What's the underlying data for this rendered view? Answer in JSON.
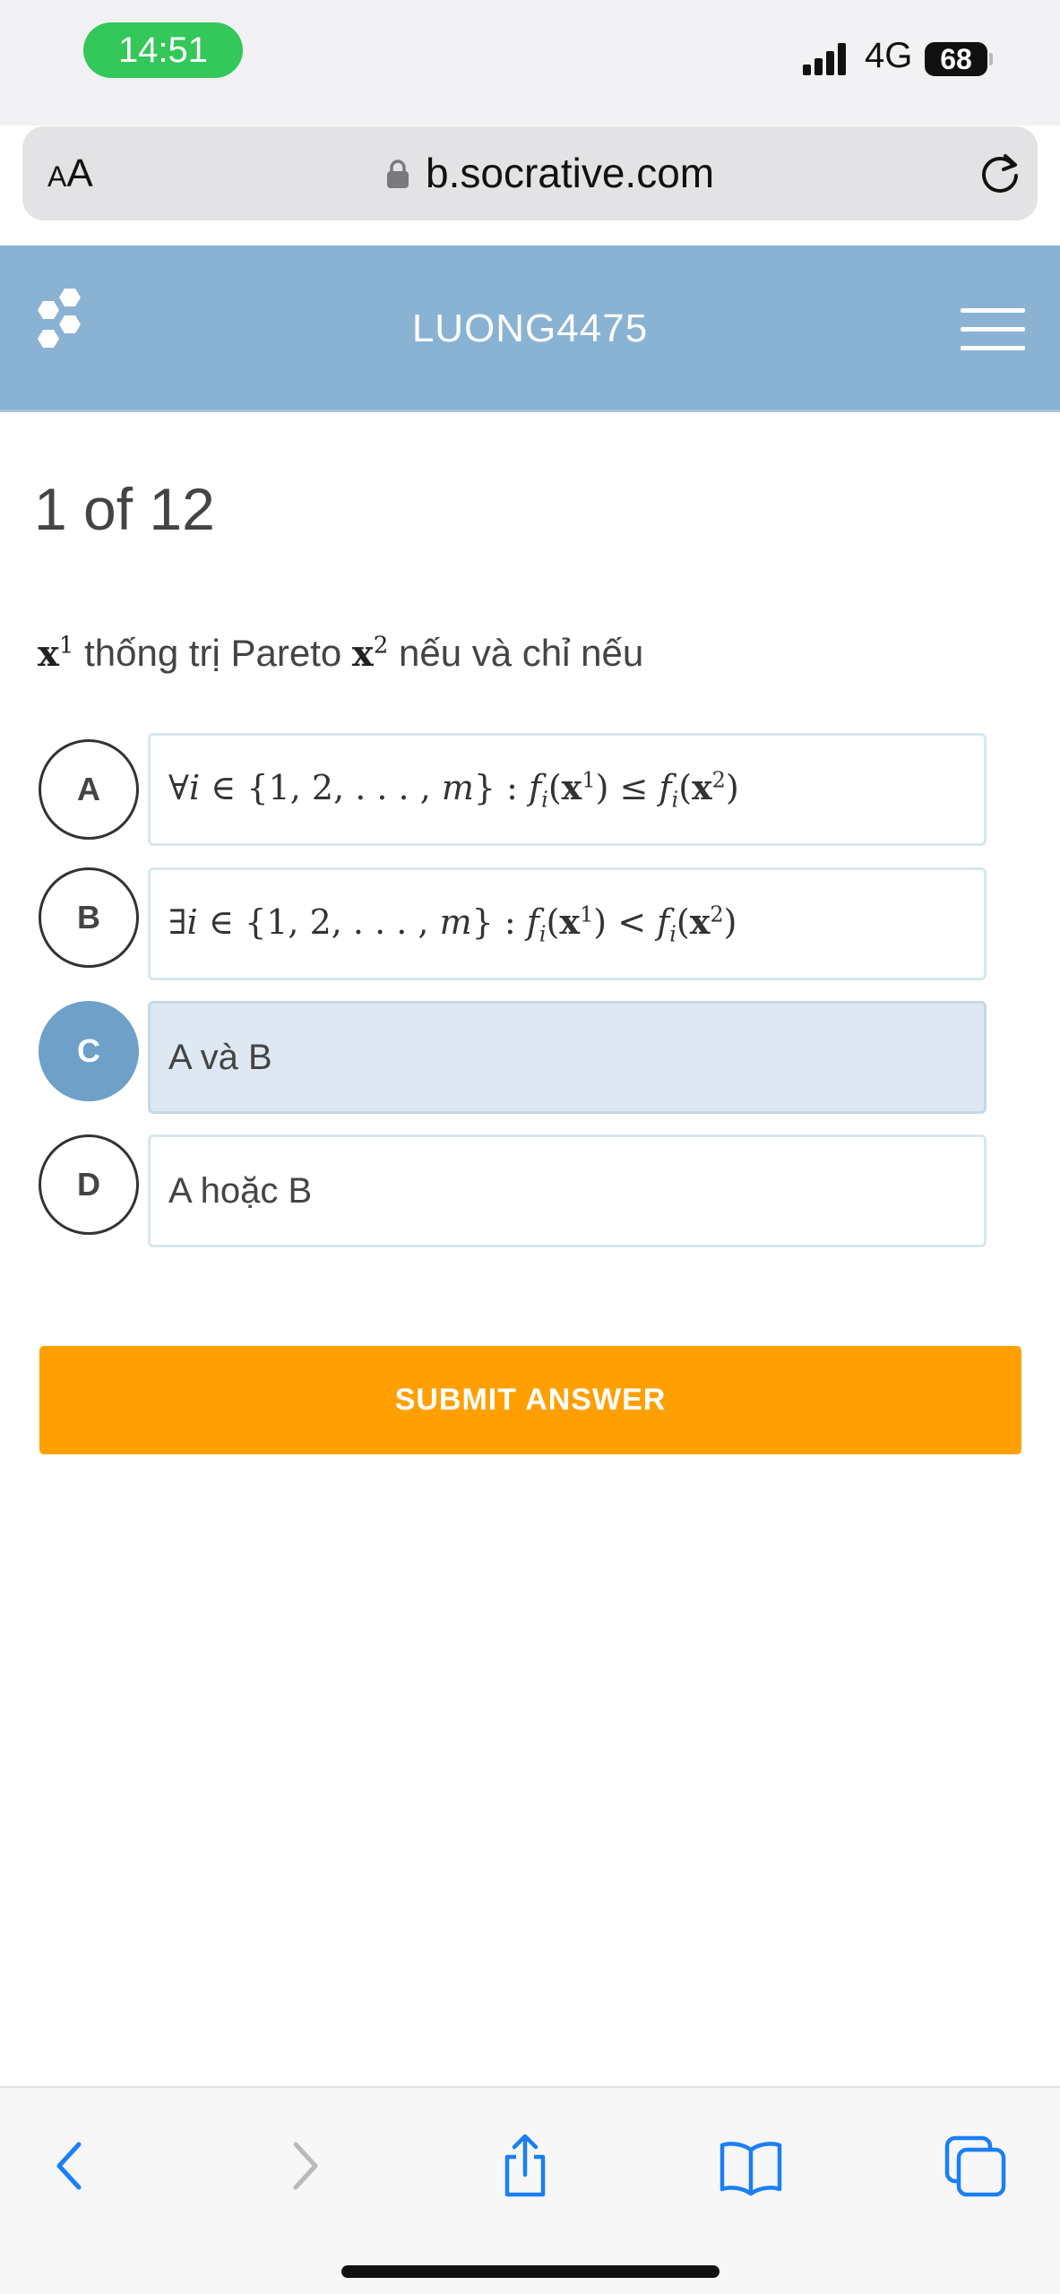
{
  "status_bar": {
    "time": "14:51",
    "network": "4G",
    "battery": "68"
  },
  "browser": {
    "aa_small": "A",
    "aa_large": "A",
    "url": "b.socrative.com"
  },
  "header": {
    "room_name": "LUONG4475"
  },
  "quiz": {
    "progress": "1 of 12",
    "question": {
      "subject_vec": "x",
      "subject_sup": "1",
      "text_1": " thống trị Pareto ",
      "object_vec": "x",
      "object_sup": "2",
      "text_2": " nếu và chỉ nếu"
    },
    "choices": [
      {
        "letter": "A",
        "quantifier": "∀",
        "index_var": "i",
        "set_text": " ∈ {1, 2, . . . , ",
        "set_end": "m",
        "set_close": "} : ",
        "relation": " ≤ ",
        "selected": false
      },
      {
        "letter": "B",
        "quantifier": "∃",
        "index_var": "i",
        "set_text": " ∈ {1, 2, . . . , ",
        "set_end": "m",
        "set_close": "} : ",
        "relation": " < ",
        "selected": false
      },
      {
        "letter": "C",
        "text": "A và B",
        "selected": true
      },
      {
        "letter": "D",
        "text": "A hoặc B",
        "selected": false
      }
    ],
    "math_tokens": {
      "f": "f",
      "sub_i": "i",
      "open": "(",
      "close": ")",
      "vec": "x",
      "sup1": "1",
      "sup2": "2"
    },
    "submit_label": "SUBMIT ANSWER"
  },
  "colors": {
    "header_bg": "#8ab2d3",
    "submit_bg": "#ffa000",
    "selected_circle": "#6fa0c8",
    "selected_box": "#dde8f2",
    "time_pill": "#34c759",
    "ios_blue": "#1a7ff5"
  },
  "toolbar_icons": [
    "back-icon",
    "forward-icon",
    "share-icon",
    "bookmarks-icon",
    "tabs-icon"
  ]
}
